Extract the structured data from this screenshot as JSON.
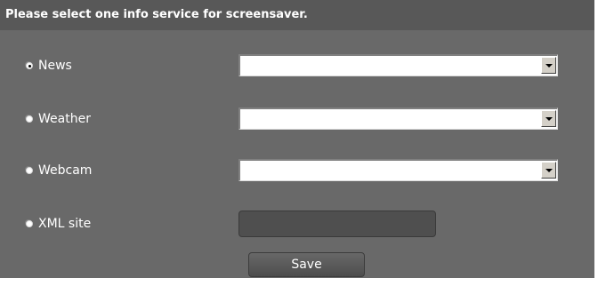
{
  "header": {
    "title": "Please select one info service for screensaver."
  },
  "options": [
    {
      "label": "News",
      "selected": true,
      "control": "dropdown",
      "value": ""
    },
    {
      "label": "Weather",
      "selected": false,
      "control": "dropdown",
      "value": ""
    },
    {
      "label": "Webcam",
      "selected": false,
      "control": "dropdown",
      "value": ""
    },
    {
      "label": "XML site",
      "selected": false,
      "control": "text",
      "value": ""
    }
  ],
  "save_label": "Save",
  "colors": {
    "panel_background": "#696969",
    "header_background": "#585858",
    "text": "#ffffff"
  }
}
